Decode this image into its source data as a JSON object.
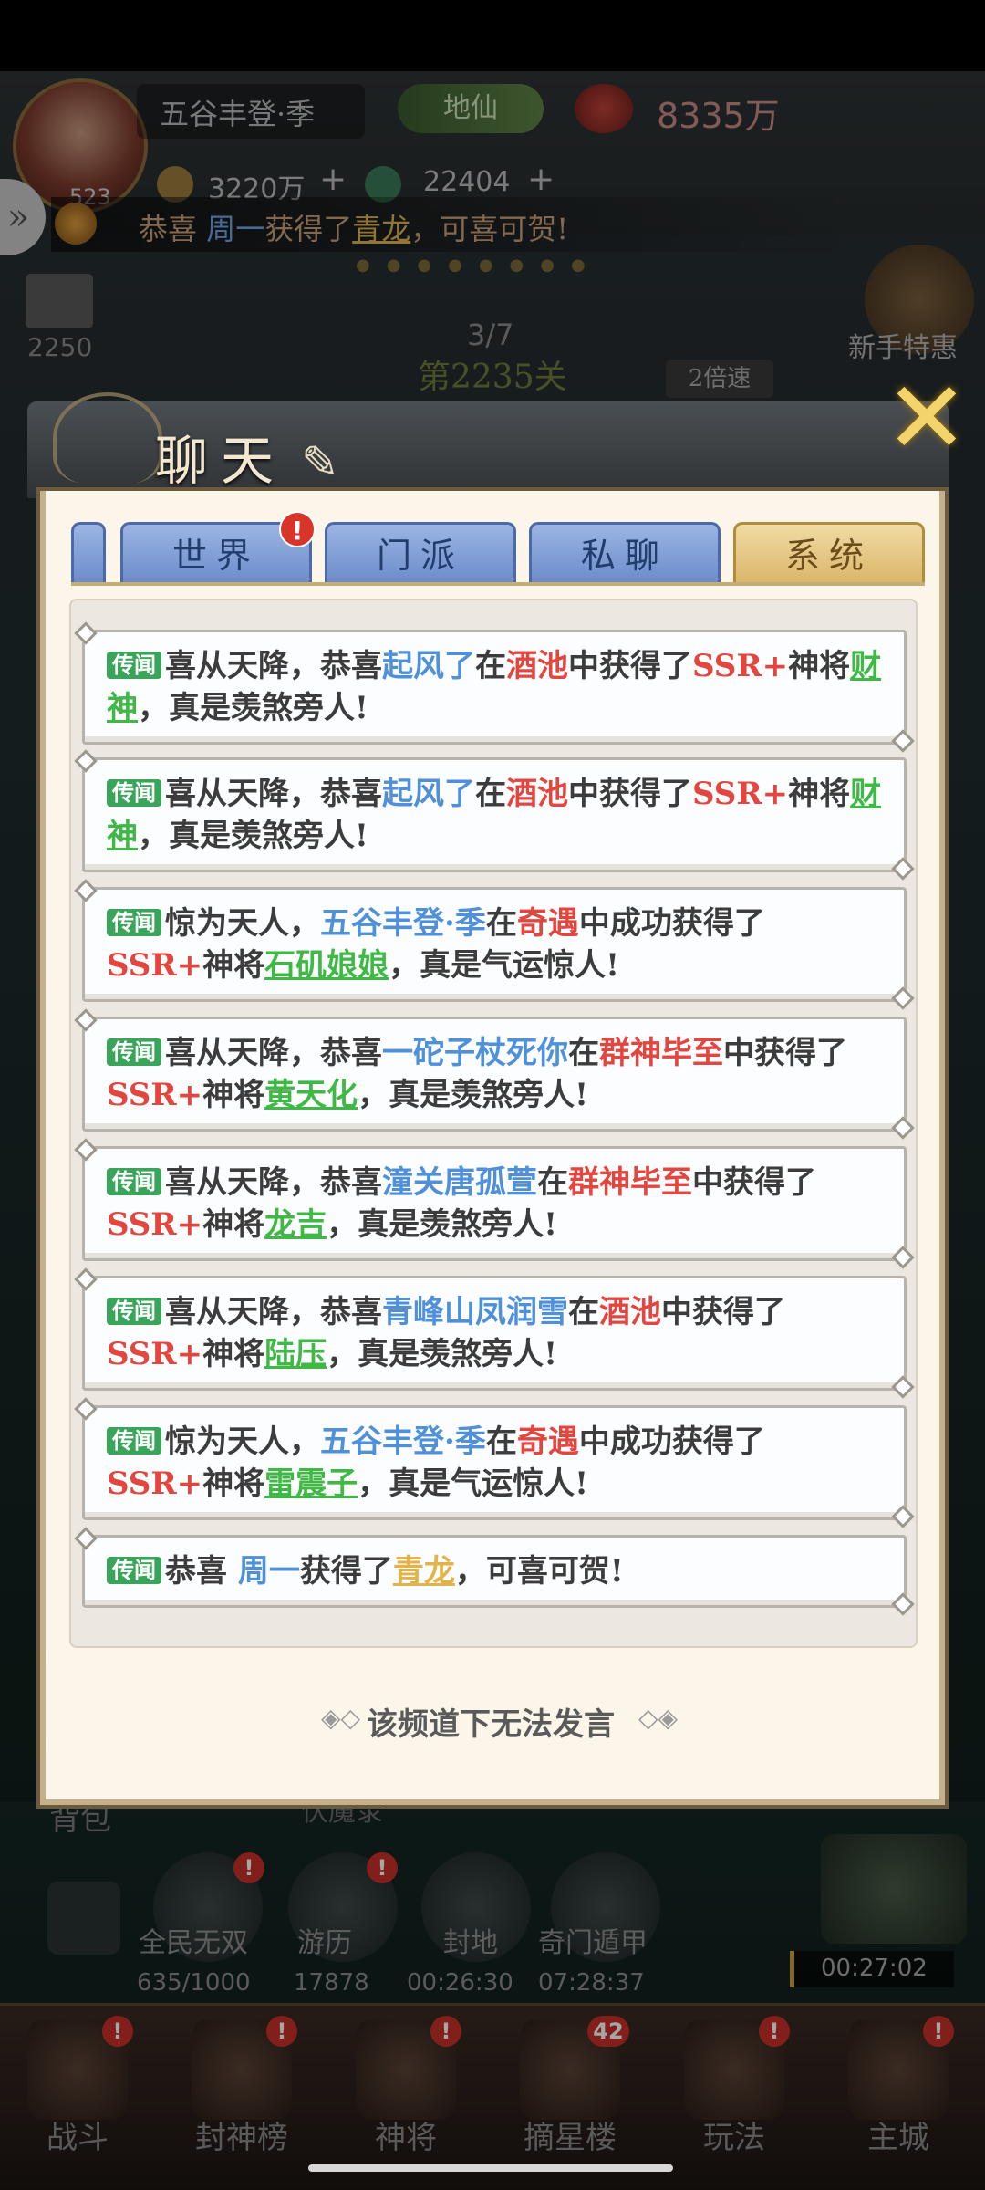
{
  "player": {
    "name": "五谷丰登·季",
    "level": "523",
    "rank": "地仙",
    "power": "8335万",
    "gold": "3220万",
    "jade": "22404"
  },
  "ticker": {
    "prefix": "恭喜 ",
    "player": "周一",
    "mid": "获得了",
    "item": "青龙",
    "suffix": "，可喜可贺!"
  },
  "stage": {
    "progress": "3/7",
    "name": "第2235关",
    "speed": "2倍速"
  },
  "left_panel": {
    "count": "2250"
  },
  "novice_gift": {
    "label": "新手特惠"
  },
  "chat": {
    "title": "聊天",
    "tabs": [
      {
        "label": "世界",
        "active": false,
        "alert": "!"
      },
      {
        "label": "门派",
        "active": false
      },
      {
        "label": "私聊",
        "active": false
      },
      {
        "label": "系统",
        "active": true
      }
    ],
    "tag": "传闻",
    "messages": [
      {
        "a": "喜从天降，恭喜",
        "player": "起风了",
        "b": "在",
        "place": "酒池",
        "c": "中获得了",
        "rarity": "SSR+",
        "d": "神将",
        "hero": "财神",
        "e": "，真是羡煞旁人!"
      },
      {
        "a": "喜从天降，恭喜",
        "player": "起风了",
        "b": "在",
        "place": "酒池",
        "c": "中获得了",
        "rarity": "SSR+",
        "d": "神将",
        "hero": "财神",
        "e": "，真是羡煞旁人!"
      },
      {
        "a": "惊为天人，",
        "player": "五谷丰登·季",
        "b": "在",
        "place": "奇遇",
        "c": "中成功获得了",
        "rarity": "SSR+",
        "d": "神将",
        "hero": "石矶娘娘",
        "e": "，真是气运惊人!"
      },
      {
        "a": "喜从天降，恭喜",
        "player": "一砣子杖死你",
        "b": "在",
        "place": "群神毕至",
        "c": "中获得了",
        "rarity": "SSR+",
        "d": "神将",
        "hero": "黄天化",
        "e": "，真是羡煞旁人!"
      },
      {
        "a": "喜从天降，恭喜",
        "player": "潼关唐孤萱",
        "b": "在",
        "place": "群神毕至",
        "c": "中获得了",
        "rarity": "SSR+",
        "d": "神将",
        "hero": "龙吉",
        "e": "，真是羡煞旁人!"
      },
      {
        "a": "喜从天降，恭喜",
        "player": "青峰山凤润雪",
        "b": "在",
        "place": "酒池",
        "c": "中获得了",
        "rarity": "SSR+",
        "d": "神将",
        "hero": "陆压",
        "e": "，真是羡煞旁人!"
      },
      {
        "a": "惊为天人，",
        "player": "五谷丰登·季",
        "b": "在",
        "place": "奇遇",
        "c": "中成功获得了",
        "rarity": "SSR+",
        "d": "神将",
        "hero": "雷震子",
        "e": "，真是气运惊人!"
      }
    ],
    "last_message": {
      "a": "恭喜 ",
      "player": "周一",
      "b": "获得了",
      "item": "青龙",
      "c": "，可喜可贺!"
    },
    "no_speak": "该频道下无法发言"
  },
  "features": [
    {
      "label": "全民无双",
      "value": "635/1000",
      "alert": "!"
    },
    {
      "label": "游历",
      "value": "17878",
      "alert": "!"
    },
    {
      "label": "封地",
      "value": "00:26:30"
    },
    {
      "label": "奇门遁甲",
      "value": "07:28:37"
    }
  ],
  "bag_label": "背包",
  "chest_timer": "00:27:02",
  "nav": [
    {
      "label": "战斗",
      "alert": "!"
    },
    {
      "label": "封神榜",
      "alert": "!"
    },
    {
      "label": "神将",
      "alert": "!"
    },
    {
      "label": "摘星楼",
      "count": "42"
    },
    {
      "label": "玩法",
      "alert": "!"
    },
    {
      "label": "主城",
      "alert": "!"
    }
  ],
  "colors": {
    "player_name": "#4f90d9",
    "place": "#e3463f",
    "rarity": "#e3463f",
    "hero": "#3fb846",
    "item_gold": "#e2b34a",
    "active_tab": "#d9b669",
    "inactive_tab": "#6b8bc9",
    "rumor_tag": "#3aa55a"
  }
}
